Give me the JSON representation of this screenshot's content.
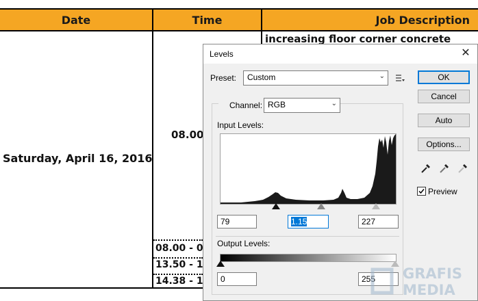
{
  "document": {
    "headers": [
      "Date",
      "Time",
      "Job Description"
    ],
    "date_text": "Saturday, April 16, 2016",
    "time_partial": "08.00",
    "job_text": "increasing floor corner concrete",
    "time_rows": [
      "08.00 - 0",
      "13.50 - 1",
      "14.38 - 1"
    ]
  },
  "dialog": {
    "title": "Levels",
    "close_glyph": "✕",
    "preset_label": "Preset:",
    "preset_value": "Custom",
    "channel_label": "Channel:",
    "channel_value": "RGB",
    "input_levels_label": "Input Levels:",
    "input_black": "79",
    "input_gamma": "1.15",
    "input_white": "227",
    "output_levels_label": "Output Levels:",
    "output_black": "0",
    "output_white": "255",
    "buttons": {
      "ok": "OK",
      "cancel": "Cancel",
      "auto": "Auto",
      "options": "Options..."
    },
    "preview_label": "Preview",
    "preview_checked": true
  },
  "watermark": {
    "line1": "GRAFIS",
    "line2": "MEDIA"
  },
  "icons": [
    "preset-menu-icon",
    "black-eyedropper-icon",
    "gray-eyedropper-icon",
    "white-eyedropper-icon",
    "checkbox-check-icon"
  ]
}
